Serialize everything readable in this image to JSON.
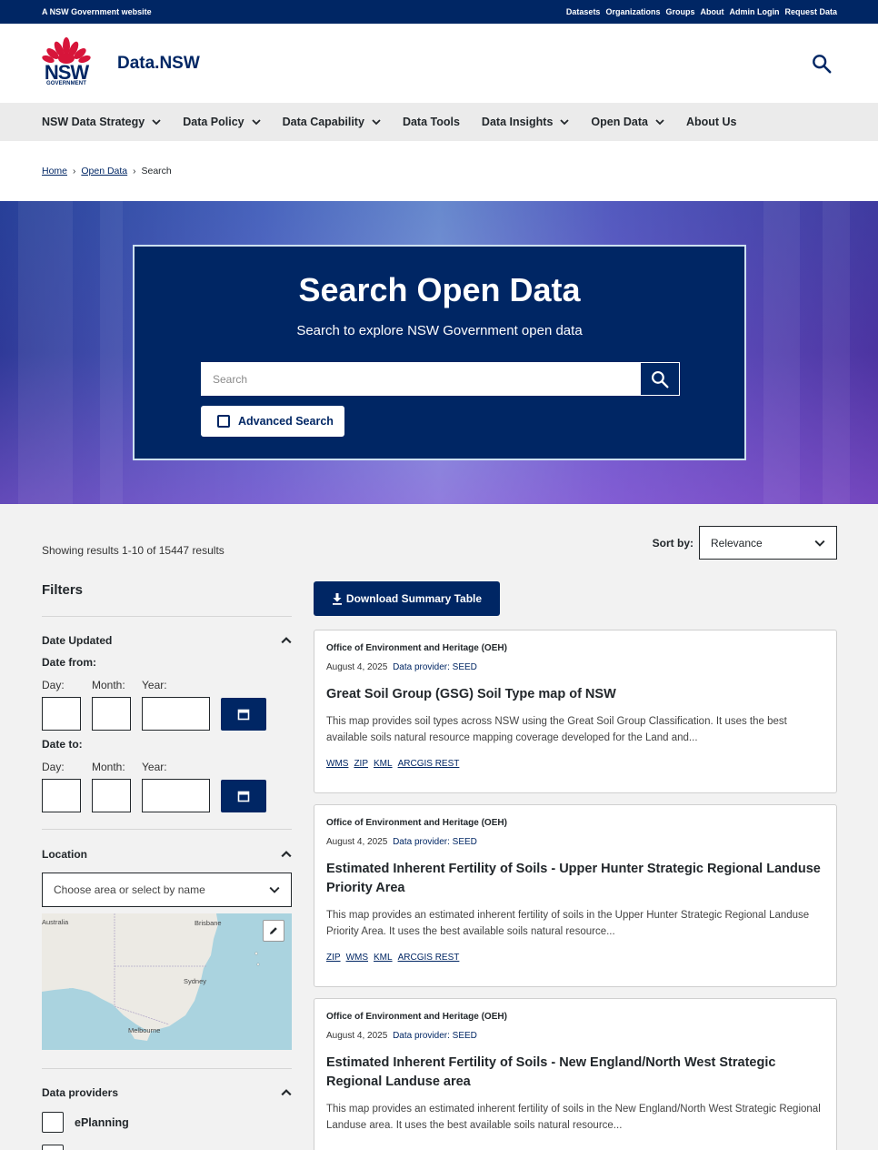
{
  "masthead": {
    "gov_label": "A NSW Government website",
    "links": [
      "Datasets",
      "Organizations",
      "Groups",
      "About",
      "Admin Login",
      "Request Data"
    ]
  },
  "header": {
    "logo_text": "NSW",
    "logo_subtext": "GOVERNMENT",
    "site_title": "Data.NSW"
  },
  "nav": [
    {
      "label": "NSW Data Strategy",
      "has_menu": true
    },
    {
      "label": "Data Policy",
      "has_menu": true
    },
    {
      "label": "Data Capability",
      "has_menu": true
    },
    {
      "label": "Data Tools",
      "has_menu": false
    },
    {
      "label": "Data Insights",
      "has_menu": true
    },
    {
      "label": "Open Data",
      "has_menu": true
    },
    {
      "label": "About Us",
      "has_menu": false
    }
  ],
  "breadcrumb": {
    "home": "Home",
    "open_data": "Open Data",
    "current": "Search"
  },
  "hero": {
    "title": "Search Open Data",
    "subtitle": "Search to explore NSW Government open data",
    "search_placeholder": "Search",
    "advanced_label": "Advanced Search"
  },
  "results": {
    "showing": "Showing results 1-10 of 15447 results",
    "sort_label": "Sort by:",
    "sort_value": "Relevance",
    "download_label": "Download Summary Table"
  },
  "filters": {
    "title": "Filters",
    "date_section": "Date Updated",
    "date_from": "Date from:",
    "date_to": "Date to:",
    "day": "Day:",
    "month": "Month:",
    "year": "Year:",
    "location_section": "Location",
    "location_placeholder": "Choose area or select by name",
    "map_labels": {
      "australia": "Australia",
      "brisbane": "Brisbane",
      "sydney": "Sydney",
      "melbourne": "Melbourne"
    },
    "providers_section": "Data providers",
    "providers": [
      "ePlanning"
    ]
  },
  "datasets": [
    {
      "org": "Office of Environment and Heritage (OEH)",
      "date": "August 4, 2025",
      "provider": "Data provider: SEED",
      "title": "Great Soil Group (GSG) Soil Type map of NSW",
      "description": "This map provides soil types across NSW using the Great Soil Group Classification. It uses the best available soils natural resource mapping coverage developed for the Land and...",
      "formats": [
        "WMS",
        "ZIP",
        "KML",
        "ARCGIS REST"
      ]
    },
    {
      "org": "Office of Environment and Heritage (OEH)",
      "date": "August 4, 2025",
      "provider": "Data provider: SEED",
      "title": "Estimated Inherent Fertility of Soils - Upper Hunter Strategic Regional Landuse Priority Area",
      "description": "This map provides an estimated inherent fertility of soils in the Upper Hunter Strategic Regional Landuse Priority Area. It uses the best available soils natural resource...",
      "formats": [
        "ZIP",
        "WMS",
        "KML",
        "ARCGIS REST"
      ]
    },
    {
      "org": "Office of Environment and Heritage (OEH)",
      "date": "August 4, 2025",
      "provider": "Data provider: SEED",
      "title": "Estimated Inherent Fertility of Soils - New England/North West Strategic Regional Landuse area",
      "description": "This map provides an estimated inherent fertility of soils in the New England/North West Strategic Regional Landuse area. It uses the best available soils natural resource...",
      "formats": []
    }
  ],
  "colors": {
    "navy": "#002664",
    "waratah_red": "#d7153a",
    "page_bg": "#f2f2f2"
  }
}
